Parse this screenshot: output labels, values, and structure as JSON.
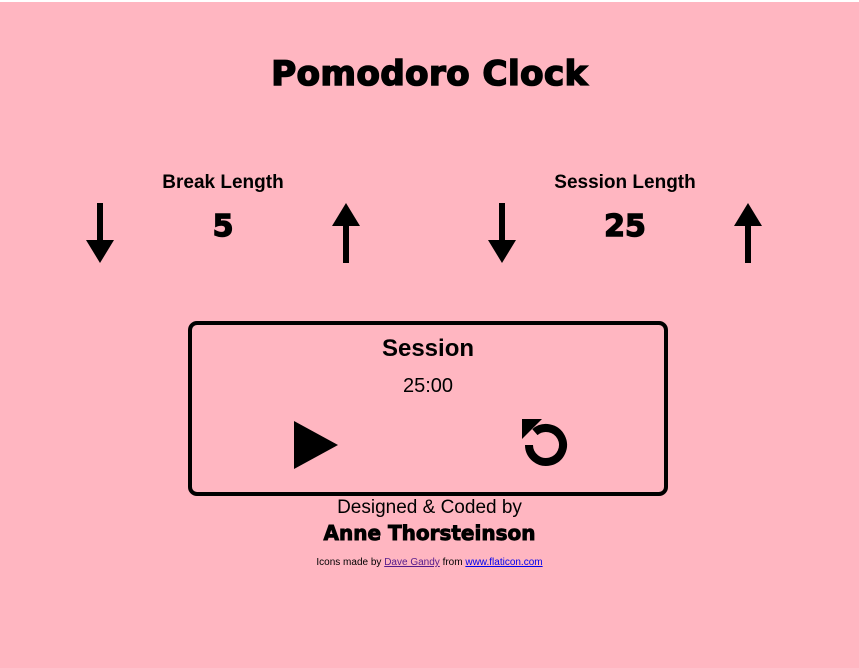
{
  "colors": {
    "background": "#ffb6c1",
    "text": "#000000",
    "link": "#0000ee",
    "link_visited": "#551a8b"
  },
  "header": {
    "title": "Pomodoro Clock"
  },
  "break_control": {
    "label": "Break Length",
    "value": "5",
    "decrement_icon": "arrow-down-icon",
    "increment_icon": "arrow-up-icon"
  },
  "session_control": {
    "label": "Session Length",
    "value": "25",
    "decrement_icon": "arrow-down-icon",
    "increment_icon": "arrow-up-icon"
  },
  "timer": {
    "label": "Session",
    "time_left": "25:00",
    "start_icon": "play-icon",
    "reset_icon": "reset-icon"
  },
  "footer": {
    "credit": "Designed & Coded by",
    "author": "Anne Thorsteinson",
    "attribution_prefix": "Icons made by",
    "attribution_author": "Dave Gandy",
    "attribution_middle": "from",
    "attribution_site": "www.flaticon.com"
  }
}
